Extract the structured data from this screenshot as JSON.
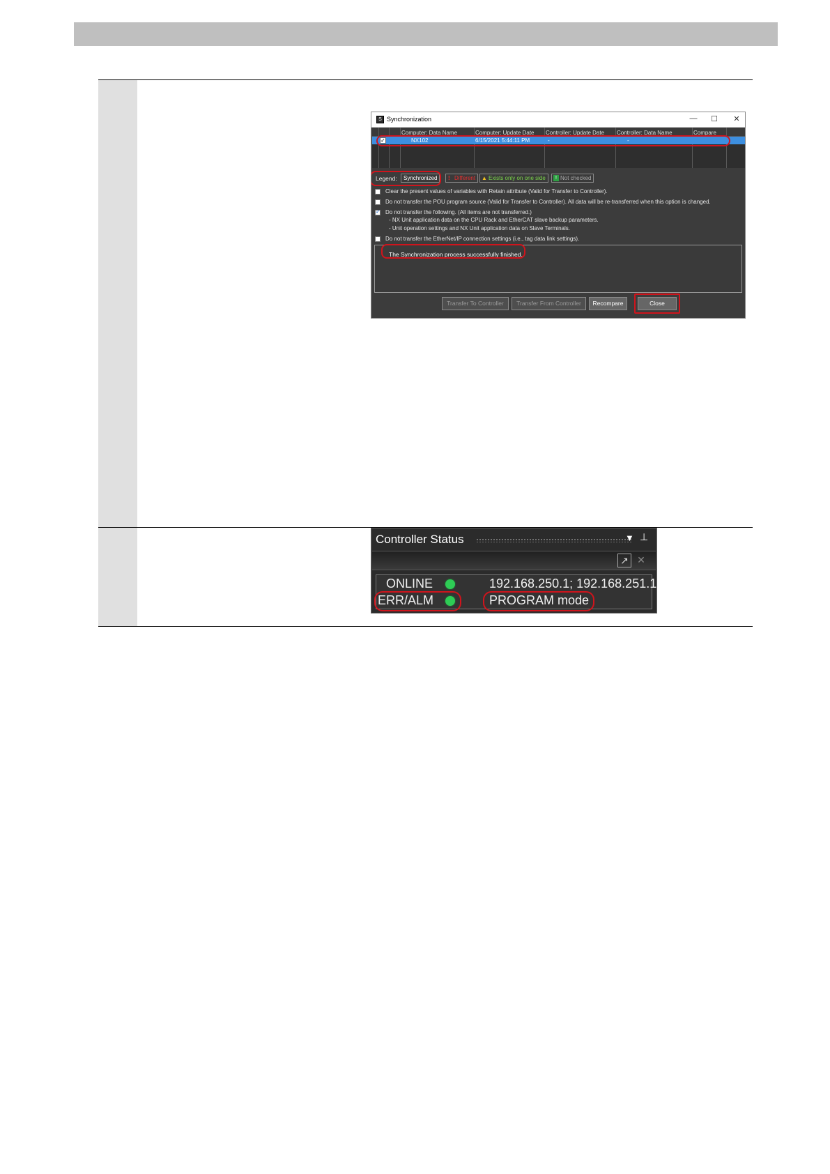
{
  "sync_dialog": {
    "title": "Synchronization",
    "window_controls": [
      "—",
      "☐",
      "✕"
    ],
    "columns": [
      "Computer: Data Name",
      "Computer: Update Date",
      "Controller: Update Date",
      "Controller: Data Name",
      "Compare"
    ],
    "rows": [
      {
        "checked": true,
        "computer_data_name": "NX102",
        "computer_update_date": "6/15/2021 5:44:11 PM",
        "controller_update_date": "-",
        "controller_data_name": "-",
        "compare": ""
      }
    ],
    "legend": {
      "label": "Legend:",
      "synchronized": "Synchronized",
      "different": "Different",
      "exists_one_side": "Exists only on one side",
      "not_checked": "Not checked"
    },
    "options": [
      {
        "checked": false,
        "text": "Clear the present values of variables with Retain attribute (Valid for Transfer to Controller)."
      },
      {
        "checked": false,
        "text": "Do not transfer the POU program source (Valid for Transfer to Controller). All data will be re-transferred when this option is changed."
      },
      {
        "checked": true,
        "text": "Do not transfer the following. (All items are not transferred.)",
        "sub": [
          "- NX Unit application data on the CPU Rack and EtherCAT slave backup parameters.",
          "- Unit operation settings and NX Unit application data on Slave Terminals."
        ]
      },
      {
        "checked": false,
        "text": "Do not transfer the EtherNet/IP connection settings (i.e., tag data link settings)."
      }
    ],
    "message": "The Synchronization process successfully finished.",
    "buttons": {
      "transfer_to": "Transfer To Controller",
      "transfer_from": "Transfer From Controller",
      "recompare": "Recompare",
      "close": "Close"
    },
    "colors": {
      "selection": "#3d8fe0",
      "highlight": "#d0141c"
    }
  },
  "controller_status": {
    "title": "Controller Status",
    "online_label": "ONLINE",
    "online_value": "192.168.250.1; 192.168.251.1",
    "err_label": "ERR/ALM",
    "mode_value": "PROGRAM mode",
    "led_color": "#2ecc55"
  }
}
